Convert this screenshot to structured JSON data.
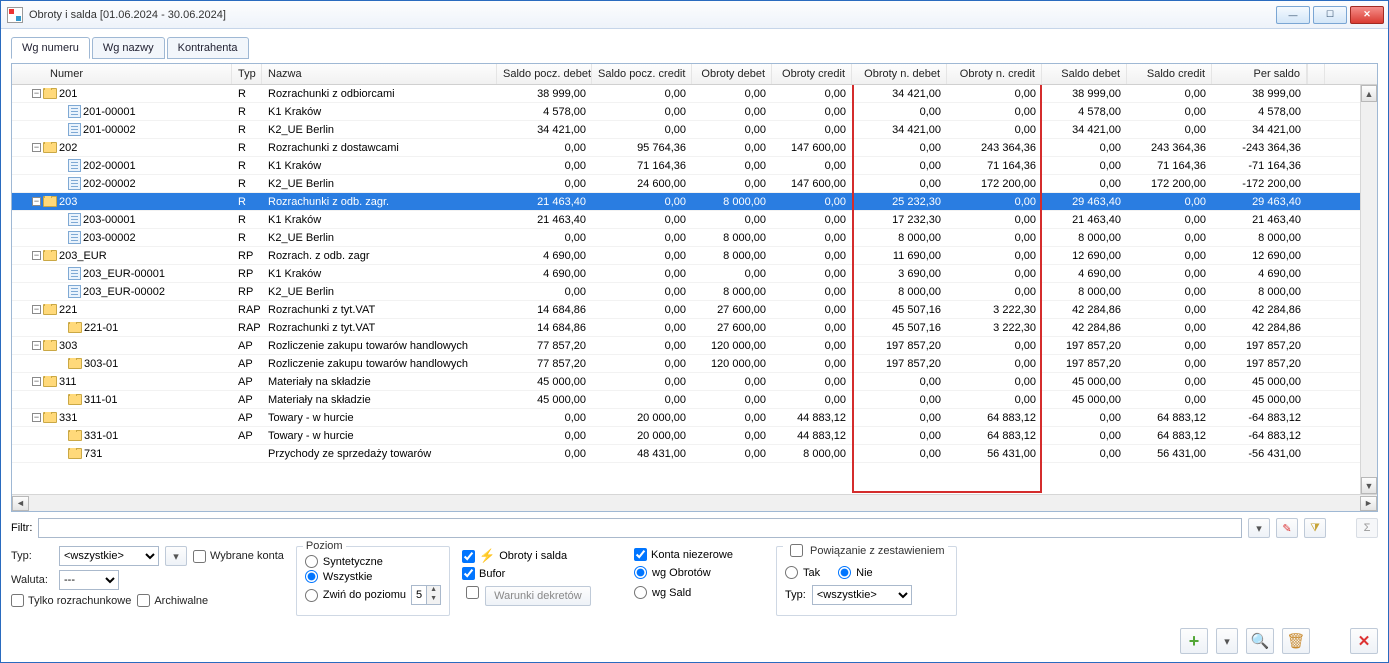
{
  "window": {
    "title": "Obroty i salda [01.06.2024 - 30.06.2024]"
  },
  "tabs": [
    "Wg numeru",
    "Wg nazwy",
    "Kontrahenta"
  ],
  "columns": {
    "c0": "Numer",
    "c1": "Typ",
    "c2": "Nazwa",
    "c3": "Saldo pocz. debet",
    "c4": "Saldo pocz. credit",
    "c5": "Obroty debet",
    "c6": "Obroty credit",
    "c7": "Obroty n. debet",
    "c8": "Obroty n. credit",
    "c9": "Saldo debet",
    "c10": "Saldo credit",
    "c11": "Per saldo"
  },
  "rows": [
    {
      "lvl": 0,
      "exp": "-",
      "ico": "f",
      "num": "201",
      "typ": "R",
      "nazwa": "Rozrachunki z odbiorcami",
      "v": [
        "38 999,00",
        "0,00",
        "0,00",
        "0,00",
        "34 421,00",
        "0,00",
        "38 999,00",
        "0,00",
        "38 999,00"
      ]
    },
    {
      "lvl": 1,
      "exp": "",
      "ico": "l",
      "num": "201-00001",
      "typ": "R",
      "nazwa": "K1 Kraków",
      "v": [
        "4 578,00",
        "0,00",
        "0,00",
        "0,00",
        "0,00",
        "0,00",
        "4 578,00",
        "0,00",
        "4 578,00"
      ]
    },
    {
      "lvl": 1,
      "exp": "",
      "ico": "l",
      "num": "201-00002",
      "typ": "R",
      "nazwa": "K2_UE Berlin",
      "v": [
        "34 421,00",
        "0,00",
        "0,00",
        "0,00",
        "34 421,00",
        "0,00",
        "34 421,00",
        "0,00",
        "34 421,00"
      ]
    },
    {
      "lvl": 0,
      "exp": "-",
      "ico": "f",
      "num": "202",
      "typ": "R",
      "nazwa": "Rozrachunki z dostawcami",
      "v": [
        "0,00",
        "95 764,36",
        "0,00",
        "147 600,00",
        "0,00",
        "243 364,36",
        "0,00",
        "243 364,36",
        "-243 364,36"
      ]
    },
    {
      "lvl": 1,
      "exp": "",
      "ico": "l",
      "num": "202-00001",
      "typ": "R",
      "nazwa": "K1 Kraków",
      "v": [
        "0,00",
        "71 164,36",
        "0,00",
        "0,00",
        "0,00",
        "71 164,36",
        "0,00",
        "71 164,36",
        "-71 164,36"
      ]
    },
    {
      "lvl": 1,
      "exp": "",
      "ico": "l",
      "num": "202-00002",
      "typ": "R",
      "nazwa": "K2_UE Berlin",
      "v": [
        "0,00",
        "24 600,00",
        "0,00",
        "147 600,00",
        "0,00",
        "172 200,00",
        "0,00",
        "172 200,00",
        "-172 200,00"
      ]
    },
    {
      "lvl": 0,
      "exp": "-",
      "ico": "f",
      "num": "203",
      "typ": "R",
      "nazwa": "Rozrachunki z odb. zagr.",
      "sel": true,
      "v": [
        "21 463,40",
        "0,00",
        "8 000,00",
        "0,00",
        "25 232,30",
        "0,00",
        "29 463,40",
        "0,00",
        "29 463,40"
      ]
    },
    {
      "lvl": 1,
      "exp": "",
      "ico": "l",
      "num": "203-00001",
      "typ": "R",
      "nazwa": "K1 Kraków",
      "v": [
        "21 463,40",
        "0,00",
        "0,00",
        "0,00",
        "17 232,30",
        "0,00",
        "21 463,40",
        "0,00",
        "21 463,40"
      ]
    },
    {
      "lvl": 1,
      "exp": "",
      "ico": "l",
      "num": "203-00002",
      "typ": "R",
      "nazwa": "K2_UE Berlin",
      "v": [
        "0,00",
        "0,00",
        "8 000,00",
        "0,00",
        "8 000,00",
        "0,00",
        "8 000,00",
        "0,00",
        "8 000,00"
      ]
    },
    {
      "lvl": 0,
      "exp": "-",
      "ico": "f",
      "num": "203_EUR",
      "typ": "RP",
      "nazwa": "Rozrach. z odb. zagr",
      "v": [
        "4 690,00",
        "0,00",
        "8 000,00",
        "0,00",
        "11 690,00",
        "0,00",
        "12 690,00",
        "0,00",
        "12 690,00"
      ]
    },
    {
      "lvl": 1,
      "exp": "",
      "ico": "l",
      "num": "203_EUR-00001",
      "typ": "RP",
      "nazwa": "K1 Kraków",
      "v": [
        "4 690,00",
        "0,00",
        "0,00",
        "0,00",
        "3 690,00",
        "0,00",
        "4 690,00",
        "0,00",
        "4 690,00"
      ]
    },
    {
      "lvl": 1,
      "exp": "",
      "ico": "l",
      "num": "203_EUR-00002",
      "typ": "RP",
      "nazwa": "K2_UE Berlin",
      "v": [
        "0,00",
        "0,00",
        "8 000,00",
        "0,00",
        "8 000,00",
        "0,00",
        "8 000,00",
        "0,00",
        "8 000,00"
      ]
    },
    {
      "lvl": 0,
      "exp": "-",
      "ico": "f",
      "num": "221",
      "typ": "RAP",
      "nazwa": "Rozrachunki z tyt.VAT",
      "v": [
        "14 684,86",
        "0,00",
        "27 600,00",
        "0,00",
        "45 507,16",
        "3 222,30",
        "42 284,86",
        "0,00",
        "42 284,86"
      ]
    },
    {
      "lvl": 1,
      "exp": "",
      "ico": "f",
      "num": "221-01",
      "typ": "RAP",
      "nazwa": "Rozrachunki z tyt.VAT",
      "v": [
        "14 684,86",
        "0,00",
        "27 600,00",
        "0,00",
        "45 507,16",
        "3 222,30",
        "42 284,86",
        "0,00",
        "42 284,86"
      ]
    },
    {
      "lvl": 0,
      "exp": "-",
      "ico": "f",
      "num": "303",
      "typ": "AP",
      "nazwa": "Rozliczenie zakupu towarów handlowych",
      "v": [
        "77 857,20",
        "0,00",
        "120 000,00",
        "0,00",
        "197 857,20",
        "0,00",
        "197 857,20",
        "0,00",
        "197 857,20"
      ]
    },
    {
      "lvl": 1,
      "exp": "",
      "ico": "f",
      "num": "303-01",
      "typ": "AP",
      "nazwa": "Rozliczenie zakupu towarów handlowych",
      "v": [
        "77 857,20",
        "0,00",
        "120 000,00",
        "0,00",
        "197 857,20",
        "0,00",
        "197 857,20",
        "0,00",
        "197 857,20"
      ]
    },
    {
      "lvl": 0,
      "exp": "-",
      "ico": "f",
      "num": "311",
      "typ": "AP",
      "nazwa": "Materiały na składzie",
      "v": [
        "45 000,00",
        "0,00",
        "0,00",
        "0,00",
        "0,00",
        "0,00",
        "45 000,00",
        "0,00",
        "45 000,00"
      ]
    },
    {
      "lvl": 1,
      "exp": "",
      "ico": "f",
      "num": "311-01",
      "typ": "AP",
      "nazwa": "Materiały na składzie",
      "v": [
        "45 000,00",
        "0,00",
        "0,00",
        "0,00",
        "0,00",
        "0,00",
        "45 000,00",
        "0,00",
        "45 000,00"
      ]
    },
    {
      "lvl": 0,
      "exp": "-",
      "ico": "f",
      "num": "331",
      "typ": "AP",
      "nazwa": "Towary - w hurcie",
      "v": [
        "0,00",
        "20 000,00",
        "0,00",
        "44 883,12",
        "0,00",
        "64 883,12",
        "0,00",
        "64 883,12",
        "-64 883,12"
      ]
    },
    {
      "lvl": 1,
      "exp": "",
      "ico": "f",
      "num": "331-01",
      "typ": "AP",
      "nazwa": "Towary - w hurcie",
      "v": [
        "0,00",
        "20 000,00",
        "0,00",
        "44 883,12",
        "0,00",
        "64 883,12",
        "0,00",
        "64 883,12",
        "-64 883,12"
      ]
    },
    {
      "lvl": 1,
      "exp": "",
      "ico": "f",
      "num": "731",
      "typ": "",
      "nazwa": "Przychody ze sprzedaży towarów",
      "v": [
        "0,00",
        "48 431,00",
        "0,00",
        "8 000,00",
        "0,00",
        "56 431,00",
        "0,00",
        "56 431,00",
        "-56 431,00"
      ]
    }
  ],
  "filter": {
    "label": "Filtr:",
    "value": ""
  },
  "left_panel": {
    "typ_label": "Typ:",
    "typ_value": "<wszystkie>",
    "typ_btn": "▾",
    "waluta_label": "Waluta:",
    "waluta_value": "---",
    "wybrane": "Wybrane konta",
    "rozrach": "Tylko rozrachunkowe",
    "arch": "Archiwalne"
  },
  "poziom": {
    "legend": "Poziom",
    "r1": "Syntetyczne",
    "r2": "Wszystkie",
    "r3": "Zwiń do poziomu",
    "spin": "5"
  },
  "mid": {
    "obroty": "Obroty i salda",
    "bufor": "Bufor",
    "warunki": "Warunki dekretów"
  },
  "kn": {
    "konta": "Konta niezerowe",
    "r1": "wg Obrotów",
    "r2": "wg Sald"
  },
  "pz": {
    "legend": "Powiązanie z zestawieniem",
    "tak": "Tak",
    "nie": "Nie",
    "typ_label": "Typ:",
    "typ_value": "<wszystkie>"
  },
  "footer_icons": {
    "add": "+",
    "dd": "▾",
    "search": "🔍",
    "trash": "🗑",
    "close": "✕"
  }
}
